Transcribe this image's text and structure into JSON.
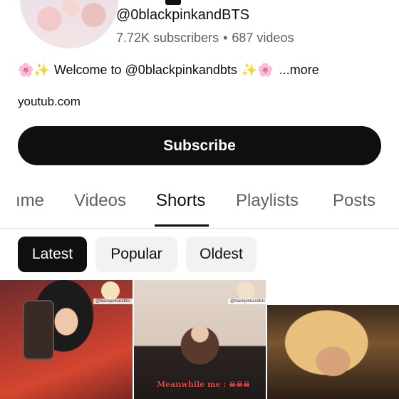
{
  "channel": {
    "handle": "@0blackpinkandBTS",
    "subscribers": "7.72K subscribers",
    "separator": "•",
    "videos": "687 videos",
    "description": {
      "emoji_left": "🌸✨",
      "text": "Welcome to @0blackpinkandbts",
      "emoji_right": "✨🌸",
      "more": "...more"
    },
    "link": "youtub.com"
  },
  "subscribe_label": "Subscribe",
  "tabs": [
    {
      "label": "ıme",
      "active": false
    },
    {
      "label": "Videos",
      "active": false
    },
    {
      "label": "Shorts",
      "active": true
    },
    {
      "label": "Playlists",
      "active": false
    },
    {
      "label": "Posts",
      "active": false
    }
  ],
  "chips": [
    {
      "label": "Latest",
      "active": true
    },
    {
      "label": "Popular",
      "active": false
    },
    {
      "label": "Oldest",
      "active": false
    }
  ],
  "shorts": [
    {
      "watermark": "@blackpinkandbts"
    },
    {
      "watermark": "@blackpinkandbts",
      "caption": "Meanwhile me : ☠☠☠"
    },
    {}
  ]
}
